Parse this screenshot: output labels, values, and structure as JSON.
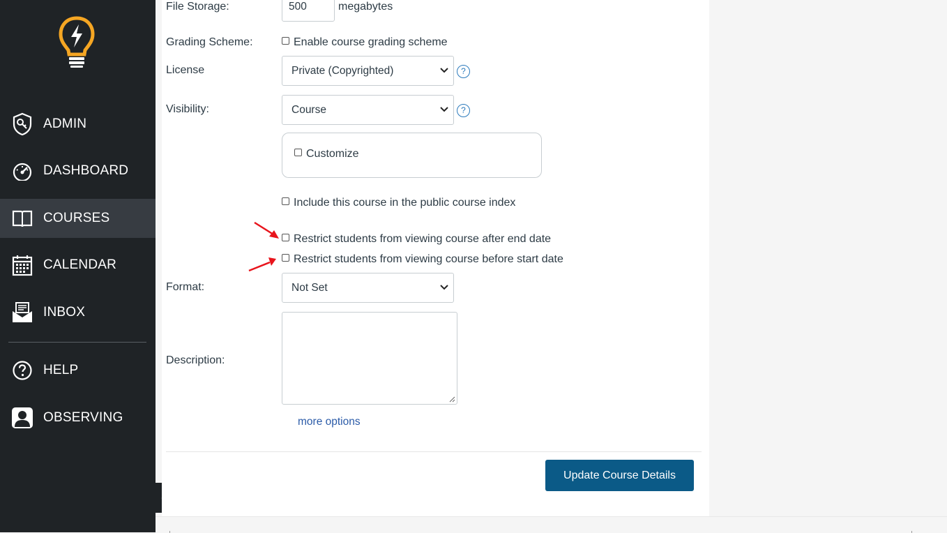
{
  "sidebar": {
    "items": [
      {
        "label": "ADMIN",
        "icon": "admin-shield-icon"
      },
      {
        "label": "DASHBOARD",
        "icon": "dashboard-gauge-icon"
      },
      {
        "label": "COURSES",
        "icon": "book-icon"
      },
      {
        "label": "CALENDAR",
        "icon": "calendar-icon"
      },
      {
        "label": "INBOX",
        "icon": "inbox-icon"
      },
      {
        "label": "HELP",
        "icon": "help-circle-icon"
      },
      {
        "label": "OBSERVING",
        "icon": "observer-avatar-icon"
      }
    ],
    "active": "COURSES",
    "logo_color": "#f5a623"
  },
  "form": {
    "file_storage": {
      "label": "File Storage:",
      "value": "500",
      "unit": "megabytes"
    },
    "grading_scheme": {
      "label": "Grading Scheme:",
      "checkbox_label": "Enable course grading scheme",
      "checked": false
    },
    "license": {
      "label": "License",
      "selected": "Private (Copyrighted)",
      "help": "?"
    },
    "visibility": {
      "label": "Visibility:",
      "selected": "Course",
      "help": "?"
    },
    "customize": {
      "checkbox_label": "Customize",
      "checked": false
    },
    "public_index": {
      "checkbox_label": "Include this course in the public course index",
      "checked": false
    },
    "restrict_after_end": {
      "checkbox_label": "Restrict students from viewing course after end date",
      "checked": false
    },
    "restrict_before_start": {
      "checkbox_label": "Restrict students from viewing course before start date",
      "checked": false
    },
    "format": {
      "label": "Format:",
      "selected": "Not Set"
    },
    "description": {
      "label": "Description:",
      "value": ""
    },
    "more_options": "more options",
    "submit": "Update Course Details"
  },
  "colors": {
    "sidebar_bg": "#1f2326",
    "active_bg": "#373c42",
    "primary_button": "#0b5a87",
    "link": "#2b5ba8",
    "annotation_arrow": "#e8141c"
  }
}
